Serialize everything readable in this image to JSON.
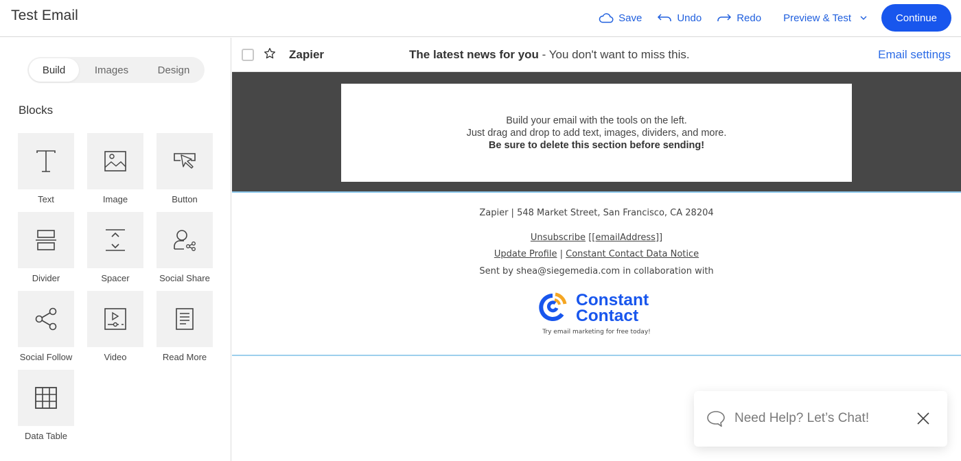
{
  "header": {
    "title": "Test Email",
    "save_label": "Save",
    "undo_label": "Undo",
    "redo_label": "Redo",
    "preview_label": "Preview & Test",
    "continue_label": "Continue"
  },
  "sidebar": {
    "tabs": [
      {
        "label": "Build",
        "active": true
      },
      {
        "label": "Images",
        "active": false
      },
      {
        "label": "Design",
        "active": false
      }
    ],
    "section_title": "Blocks",
    "blocks": [
      {
        "label": "Text",
        "icon": "text-icon"
      },
      {
        "label": "Image",
        "icon": "image-icon"
      },
      {
        "label": "Button",
        "icon": "button-cursor-icon"
      },
      {
        "label": "Divider",
        "icon": "divider-icon"
      },
      {
        "label": "Spacer",
        "icon": "spacer-icon"
      },
      {
        "label": "Social Share",
        "icon": "social-share-icon"
      },
      {
        "label": "Social Follow",
        "icon": "share-nodes-icon"
      },
      {
        "label": "Video",
        "icon": "video-icon"
      },
      {
        "label": "Read More",
        "icon": "document-icon"
      },
      {
        "label": "Data Table",
        "icon": "table-grid-icon"
      }
    ]
  },
  "inbox_preview": {
    "sender": "Zapier",
    "subject": "The latest news for you",
    "separator": " - ",
    "preheader": "You don't want to miss this.",
    "settings_label": "Email settings"
  },
  "notice": {
    "line1": "Build your email with the tools on the left.",
    "line2": "Just drag and drop to add text, images, dividers, and more.",
    "line3": "Be sure to delete this section before sending!"
  },
  "footer": {
    "address": "Zapier | 548 Market Street, San Francisco, CA 28204",
    "unsubscribe_label": "Unsubscribe",
    "unsubscribe_token": "[[emailAddress]]",
    "update_profile_label": "Update Profile",
    "links_separator": " | ",
    "data_notice_label": "Constant Contact Data Notice",
    "sent_by": "Sent by shea@siegemedia.com in collaboration with",
    "logo_line1": "Constant",
    "logo_line2": "Contact",
    "tagline": "Try email marketing for free today!"
  },
  "chat": {
    "label": "Need Help? Let’s Chat!"
  },
  "colors": {
    "accent": "#1856ed",
    "link": "#2b6be6",
    "dark_band": "#474747",
    "logo_orange": "#f5a623",
    "tile_bg": "#f1f1f1"
  }
}
